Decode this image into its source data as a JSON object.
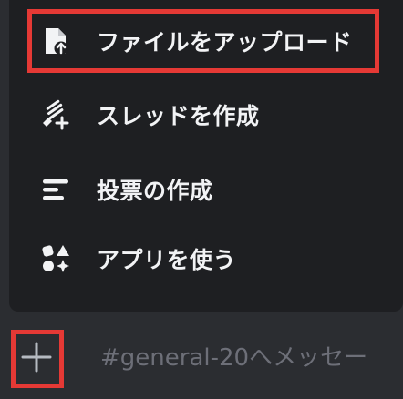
{
  "menu": {
    "items": [
      {
        "label": "ファイルをアップロード",
        "icon": "file-upload-icon"
      },
      {
        "label": "スレッドを作成",
        "icon": "thread-create-icon"
      },
      {
        "label": "投票の作成",
        "icon": "poll-icon"
      },
      {
        "label": "アプリを使う",
        "icon": "apps-icon"
      }
    ]
  },
  "composer": {
    "placeholder": "#general-20へメッセー"
  },
  "colors": {
    "menu_bg": "#1e1f22",
    "page_bg": "#2b2d31",
    "text": "#f2f3f5",
    "placeholder": "#6d6f78",
    "highlight": "#e53935"
  }
}
